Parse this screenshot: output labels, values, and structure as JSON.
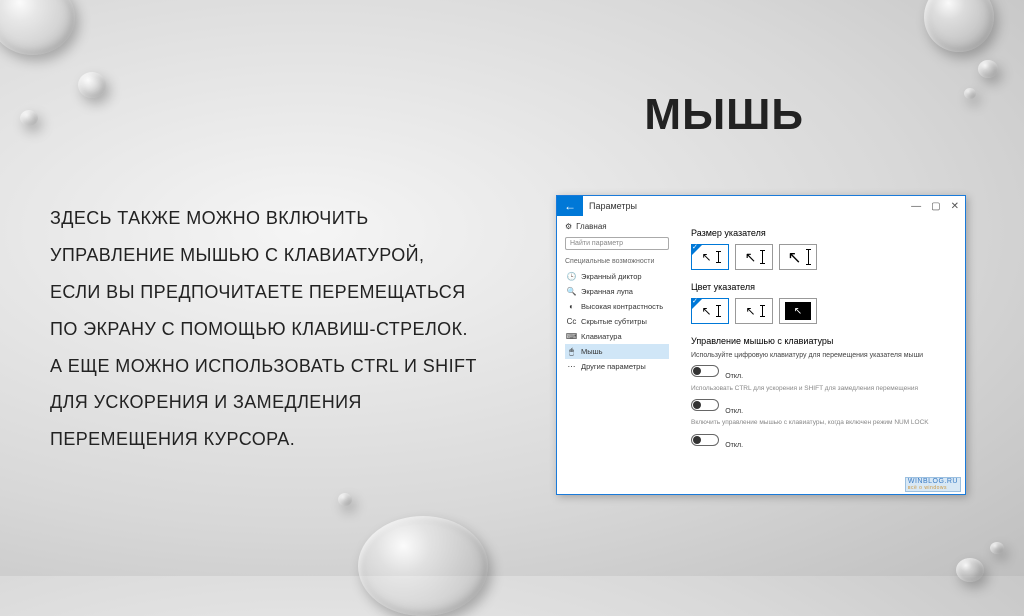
{
  "title": "МЫШЬ",
  "body": "ЗДЕСЬ ТАКЖЕ МОЖНО ВКЛЮЧИТЬ УПРАВЛЕНИЕ МЫШЬЮ С КЛАВИАТУРОЙ, ЕСЛИ ВЫ ПРЕДПОЧИТАЕТЕ ПЕРЕМЕЩАТЬСЯ ПО ЭКРАНУ С ПОМОЩЬЮ КЛАВИШ-СТРЕЛОК. А ЕЩЕ МОЖНО ИСПОЛЬЗОВАТЬ CTRL И SHIFT ДЛЯ УСКОРЕНИЯ И ЗАМЕДЛЕНИЯ ПЕРЕМЕЩЕНИЯ КУРСОРА.",
  "window": {
    "app_title": "Параметры",
    "home": "Главная",
    "search_placeholder": "Найти параметр",
    "section_label": "Специальные возможности",
    "sidebar": [
      {
        "icon": "🕒",
        "label": "Экранный диктор"
      },
      {
        "icon": "🔍",
        "label": "Экранная лупа"
      },
      {
        "icon": "◐",
        "label": "Высокая контрастность"
      },
      {
        "icon": "Cc",
        "label": "Скрытые субтитры"
      },
      {
        "icon": "⌨",
        "label": "Клавиатура"
      },
      {
        "icon": "🖱",
        "label": "Мышь"
      },
      {
        "icon": "⋯",
        "label": "Другие параметры"
      }
    ],
    "content": {
      "pointer_size_h": "Размер указателя",
      "pointer_color_h": "Цвет указателя",
      "mouse_keys_h": "Управление мышью с клавиатуры",
      "mouse_keys_desc": "Используйте цифровую клавиатуру для перемещения указателя мыши",
      "toggle_off": "Откл.",
      "ctrl_desc": "Использовать CTRL для ускорения и SHIFT для замедления перемещения",
      "numlock_desc": "Включить управление мышью с клавиатуры, когда включен режим NUM LOCK"
    },
    "watermark": "WINBLOG.RU",
    "watermark_sub": "всё о windows"
  }
}
